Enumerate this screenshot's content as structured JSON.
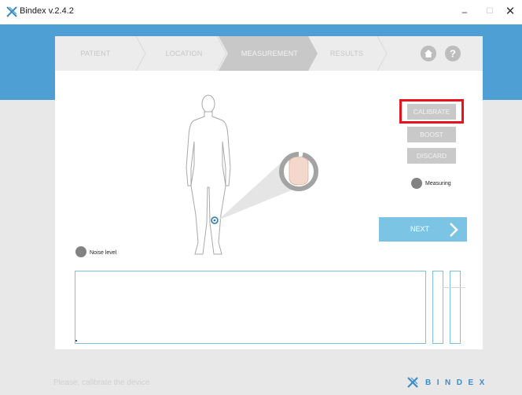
{
  "window": {
    "title": "Bindex v.2.4.2",
    "controls": [
      "–",
      "☐",
      "✕"
    ]
  },
  "steps": [
    {
      "label": "PATIENT",
      "active": false
    },
    {
      "label": "LOCATION",
      "active": false
    },
    {
      "label": "MEASUREMENT",
      "active": true
    },
    {
      "label": "RESULTS",
      "active": false
    }
  ],
  "nav_icons": [
    "home-icon",
    "help-icon"
  ],
  "buttons": {
    "calibrate": "CALIBRATE",
    "boost": "BOOST",
    "discard": "DISCARD",
    "next": "NEXT",
    "next_arrow": "›"
  },
  "indicators": {
    "measuring": "Measuring",
    "noise": "Noise level"
  },
  "status_text": "Please, calibrate the device",
  "brand": "BINDEX",
  "colors": {
    "header_blue": "#4e9fd3",
    "next_blue": "#7cc4e4",
    "highlight_red": "#e8131b",
    "indicator_gray": "#828282"
  }
}
